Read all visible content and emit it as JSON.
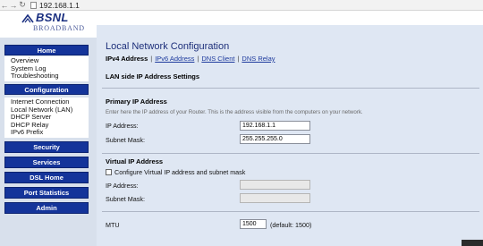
{
  "browser": {
    "url": "192.168.1.1"
  },
  "logo": {
    "name": "BSNL",
    "sub": "BROADBAND"
  },
  "sidebar": {
    "home_title": "Home",
    "home_items": [
      "Overview",
      "System Log",
      "Troubleshooting"
    ],
    "config_title": "Configuration",
    "config_items": [
      "Internet Connection",
      "Local Network (LAN)",
      "DHCP Server",
      "DHCP Relay",
      "IPv6 Prefix"
    ],
    "buttons": [
      "Security",
      "Services",
      "DSL Home",
      "Port Statistics",
      "Admin"
    ]
  },
  "main": {
    "title": "Local Network Configuration",
    "tabs": {
      "active": "IPv4 Address",
      "links": [
        "IPv6 Address",
        "DNS Client",
        "DNS Relay"
      ],
      "sep": "|"
    },
    "section_title": "LAN side IP Address Settings",
    "primary": {
      "heading": "Primary IP Address",
      "help": "Enter here the IP address of your Router. This is the address visible from the computers on your network.",
      "ip_label": "IP Address:",
      "ip_value": "192.168.1.1",
      "mask_label": "Subnet Mask:",
      "mask_value": "255.255.255.0"
    },
    "virtual": {
      "heading": "Virtual IP Address",
      "checkbox_label": "Configure Virtual IP address and subnet mask",
      "checked": false,
      "ip_label": "IP Address:",
      "ip_value": "",
      "mask_label": "Subnet Mask:",
      "mask_value": ""
    },
    "mtu": {
      "label": "MTU",
      "value": "1500",
      "default_text": "(default: 1500)"
    }
  }
}
